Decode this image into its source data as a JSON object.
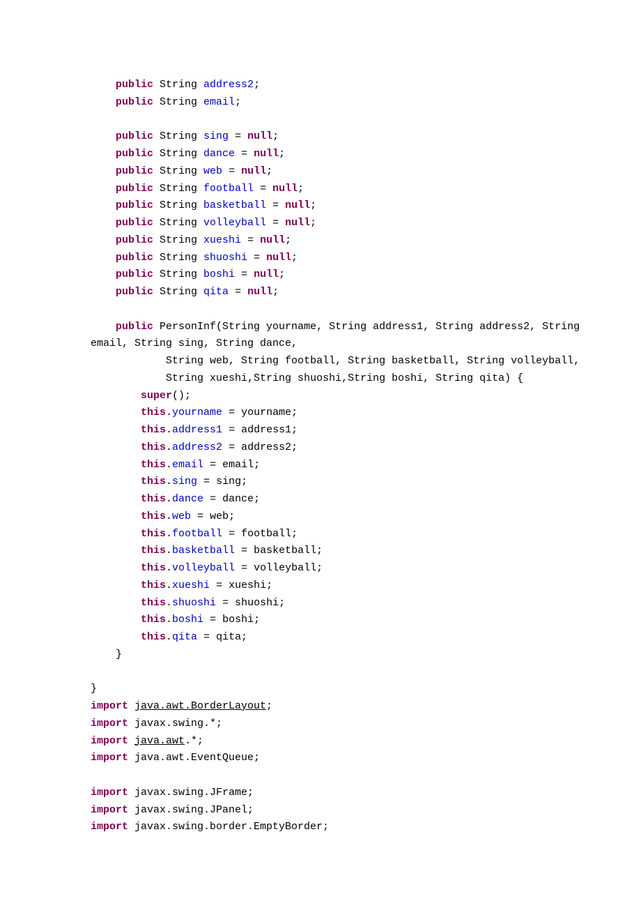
{
  "code_lines": [
    {
      "indent": 1,
      "tokens": [
        {
          "t": "public ",
          "c": "kw"
        },
        {
          "t": "String "
        },
        {
          "t": "address2",
          "c": "fld"
        },
        {
          "t": ";"
        }
      ]
    },
    {
      "indent": 1,
      "tokens": [
        {
          "t": "public ",
          "c": "kw"
        },
        {
          "t": "String "
        },
        {
          "t": "email",
          "c": "fld"
        },
        {
          "t": ";"
        }
      ]
    },
    {
      "indent": 0,
      "tokens": []
    },
    {
      "indent": 1,
      "tokens": [
        {
          "t": "public ",
          "c": "kw"
        },
        {
          "t": "String "
        },
        {
          "t": "sing",
          "c": "fld"
        },
        {
          "t": " = "
        },
        {
          "t": "null",
          "c": "kw"
        },
        {
          "t": ";"
        }
      ]
    },
    {
      "indent": 1,
      "tokens": [
        {
          "t": "public ",
          "c": "kw"
        },
        {
          "t": "String "
        },
        {
          "t": "dance",
          "c": "fld"
        },
        {
          "t": " = "
        },
        {
          "t": "null",
          "c": "kw"
        },
        {
          "t": ";"
        }
      ]
    },
    {
      "indent": 1,
      "tokens": [
        {
          "t": "public ",
          "c": "kw"
        },
        {
          "t": "String "
        },
        {
          "t": "web",
          "c": "fld"
        },
        {
          "t": " = "
        },
        {
          "t": "null",
          "c": "kw"
        },
        {
          "t": ";"
        }
      ]
    },
    {
      "indent": 1,
      "tokens": [
        {
          "t": "public ",
          "c": "kw"
        },
        {
          "t": "String "
        },
        {
          "t": "football",
          "c": "fld"
        },
        {
          "t": " = "
        },
        {
          "t": "null",
          "c": "kw"
        },
        {
          "t": ";"
        }
      ]
    },
    {
      "indent": 1,
      "tokens": [
        {
          "t": "public ",
          "c": "kw"
        },
        {
          "t": "String "
        },
        {
          "t": "basketball",
          "c": "fld"
        },
        {
          "t": " = "
        },
        {
          "t": "null",
          "c": "kw"
        },
        {
          "t": ";"
        }
      ]
    },
    {
      "indent": 1,
      "tokens": [
        {
          "t": "public ",
          "c": "kw"
        },
        {
          "t": "String "
        },
        {
          "t": "volleyball",
          "c": "fld"
        },
        {
          "t": " = "
        },
        {
          "t": "null",
          "c": "kw"
        },
        {
          "t": ";"
        }
      ]
    },
    {
      "indent": 1,
      "tokens": [
        {
          "t": "public ",
          "c": "kw"
        },
        {
          "t": "String "
        },
        {
          "t": "xueshi",
          "c": "fld"
        },
        {
          "t": " = "
        },
        {
          "t": "null",
          "c": "kw"
        },
        {
          "t": ";"
        }
      ]
    },
    {
      "indent": 1,
      "tokens": [
        {
          "t": "public ",
          "c": "kw"
        },
        {
          "t": "String "
        },
        {
          "t": "shuoshi",
          "c": "fld"
        },
        {
          "t": " = "
        },
        {
          "t": "null",
          "c": "kw"
        },
        {
          "t": ";"
        }
      ]
    },
    {
      "indent": 1,
      "tokens": [
        {
          "t": "public ",
          "c": "kw"
        },
        {
          "t": "String "
        },
        {
          "t": "boshi",
          "c": "fld"
        },
        {
          "t": " = "
        },
        {
          "t": "null",
          "c": "kw"
        },
        {
          "t": ";"
        }
      ]
    },
    {
      "indent": 1,
      "tokens": [
        {
          "t": "public ",
          "c": "kw"
        },
        {
          "t": "String "
        },
        {
          "t": "qita",
          "c": "fld"
        },
        {
          "t": " = "
        },
        {
          "t": "null",
          "c": "kw"
        },
        {
          "t": ";"
        }
      ]
    },
    {
      "indent": 0,
      "tokens": []
    },
    {
      "indent": 1,
      "tokens": [
        {
          "t": "public ",
          "c": "kw"
        },
        {
          "t": "PersonInf(String yourname, String address1, String address2, String "
        }
      ]
    },
    {
      "indent": 0,
      "tokens": [
        {
          "t": "email, String sing, String dance,"
        }
      ]
    },
    {
      "indent": 3,
      "tokens": [
        {
          "t": "String web, String football, String basketball, String volleyball,"
        }
      ]
    },
    {
      "indent": 3,
      "tokens": [
        {
          "t": "String xueshi,String shuoshi,String boshi, String qita) {"
        }
      ]
    },
    {
      "indent": 2,
      "tokens": [
        {
          "t": "super",
          "c": "kw"
        },
        {
          "t": "();"
        }
      ]
    },
    {
      "indent": 2,
      "tokens": [
        {
          "t": "this",
          "c": "kw"
        },
        {
          "t": "."
        },
        {
          "t": "yourname",
          "c": "fld"
        },
        {
          "t": " = yourname;"
        }
      ]
    },
    {
      "indent": 2,
      "tokens": [
        {
          "t": "this",
          "c": "kw"
        },
        {
          "t": "."
        },
        {
          "t": "address1",
          "c": "fld"
        },
        {
          "t": " = address1;"
        }
      ]
    },
    {
      "indent": 2,
      "tokens": [
        {
          "t": "this",
          "c": "kw"
        },
        {
          "t": "."
        },
        {
          "t": "address2",
          "c": "fld"
        },
        {
          "t": " = address2;"
        }
      ]
    },
    {
      "indent": 2,
      "tokens": [
        {
          "t": "this",
          "c": "kw"
        },
        {
          "t": "."
        },
        {
          "t": "email",
          "c": "fld"
        },
        {
          "t": " = email;"
        }
      ]
    },
    {
      "indent": 2,
      "tokens": [
        {
          "t": "this",
          "c": "kw"
        },
        {
          "t": "."
        },
        {
          "t": "sing",
          "c": "fld"
        },
        {
          "t": " = sing;"
        }
      ]
    },
    {
      "indent": 2,
      "tokens": [
        {
          "t": "this",
          "c": "kw"
        },
        {
          "t": "."
        },
        {
          "t": "dance",
          "c": "fld"
        },
        {
          "t": " = dance;"
        }
      ]
    },
    {
      "indent": 2,
      "tokens": [
        {
          "t": "this",
          "c": "kw"
        },
        {
          "t": "."
        },
        {
          "t": "web",
          "c": "fld"
        },
        {
          "t": " = web;"
        }
      ]
    },
    {
      "indent": 2,
      "tokens": [
        {
          "t": "this",
          "c": "kw"
        },
        {
          "t": "."
        },
        {
          "t": "football",
          "c": "fld"
        },
        {
          "t": " = football;"
        }
      ]
    },
    {
      "indent": 2,
      "tokens": [
        {
          "t": "this",
          "c": "kw"
        },
        {
          "t": "."
        },
        {
          "t": "basketball",
          "c": "fld"
        },
        {
          "t": " = basketball;"
        }
      ]
    },
    {
      "indent": 2,
      "tokens": [
        {
          "t": "this",
          "c": "kw"
        },
        {
          "t": "."
        },
        {
          "t": "volleyball",
          "c": "fld"
        },
        {
          "t": " = volleyball;"
        }
      ]
    },
    {
      "indent": 2,
      "tokens": [
        {
          "t": "this",
          "c": "kw"
        },
        {
          "t": "."
        },
        {
          "t": "xueshi",
          "c": "fld"
        },
        {
          "t": " = xueshi;"
        }
      ]
    },
    {
      "indent": 2,
      "tokens": [
        {
          "t": "this",
          "c": "kw"
        },
        {
          "t": "."
        },
        {
          "t": "shuoshi",
          "c": "fld"
        },
        {
          "t": " = shuoshi;"
        }
      ]
    },
    {
      "indent": 2,
      "tokens": [
        {
          "t": "this",
          "c": "kw"
        },
        {
          "t": "."
        },
        {
          "t": "boshi",
          "c": "fld"
        },
        {
          "t": " = boshi;"
        }
      ]
    },
    {
      "indent": 2,
      "tokens": [
        {
          "t": "this",
          "c": "kw"
        },
        {
          "t": "."
        },
        {
          "t": "qita",
          "c": "fld"
        },
        {
          "t": " = qita;"
        }
      ]
    },
    {
      "indent": 1,
      "tokens": [
        {
          "t": "}"
        }
      ]
    },
    {
      "indent": 0,
      "tokens": []
    },
    {
      "indent": 0,
      "tokens": [
        {
          "t": "}"
        }
      ]
    },
    {
      "indent": 0,
      "tokens": [
        {
          "t": "import ",
          "c": "kw"
        },
        {
          "t": "java.awt.BorderLayout",
          "c": "strk"
        },
        {
          "t": ";"
        }
      ]
    },
    {
      "indent": 0,
      "tokens": [
        {
          "t": "import ",
          "c": "kw"
        },
        {
          "t": "javax.swing.*;"
        }
      ]
    },
    {
      "indent": 0,
      "tokens": [
        {
          "t": "import ",
          "c": "kw"
        },
        {
          "t": "java.awt",
          "c": "strk"
        },
        {
          "t": ".*;"
        }
      ]
    },
    {
      "indent": 0,
      "tokens": [
        {
          "t": "import ",
          "c": "kw"
        },
        {
          "t": "java.awt.EventQueue;"
        }
      ]
    },
    {
      "indent": 0,
      "tokens": []
    },
    {
      "indent": 0,
      "tokens": [
        {
          "t": "import ",
          "c": "kw"
        },
        {
          "t": "javax.swing.JFrame;"
        }
      ]
    },
    {
      "indent": 0,
      "tokens": [
        {
          "t": "import ",
          "c": "kw"
        },
        {
          "t": "javax.swing.JPanel;"
        }
      ]
    },
    {
      "indent": 0,
      "tokens": [
        {
          "t": "import ",
          "c": "kw"
        },
        {
          "t": "javax.swing.border.EmptyBorder;"
        }
      ]
    }
  ],
  "indent_unit": "    "
}
